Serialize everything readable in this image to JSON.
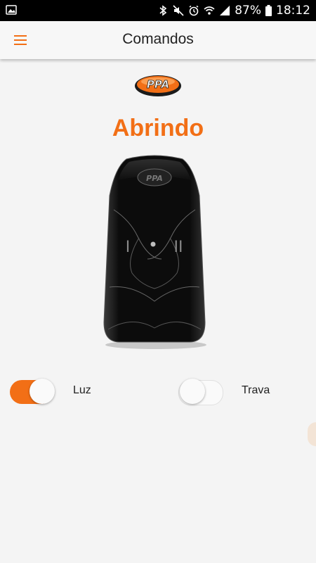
{
  "status_bar": {
    "battery": "87%",
    "time": "18:12"
  },
  "appbar": {
    "title": "Comandos"
  },
  "brand": {
    "logo_text": "PPA"
  },
  "remote": {
    "logo_text": "PPA",
    "button_left": "I",
    "button_right": "II"
  },
  "status": {
    "text": "Abrindo"
  },
  "toggles": [
    {
      "label": "Luz",
      "on": true
    },
    {
      "label": "Trava",
      "on": false
    }
  ],
  "colors": {
    "accent": "#f26f16",
    "background": "#f4f4f4"
  }
}
